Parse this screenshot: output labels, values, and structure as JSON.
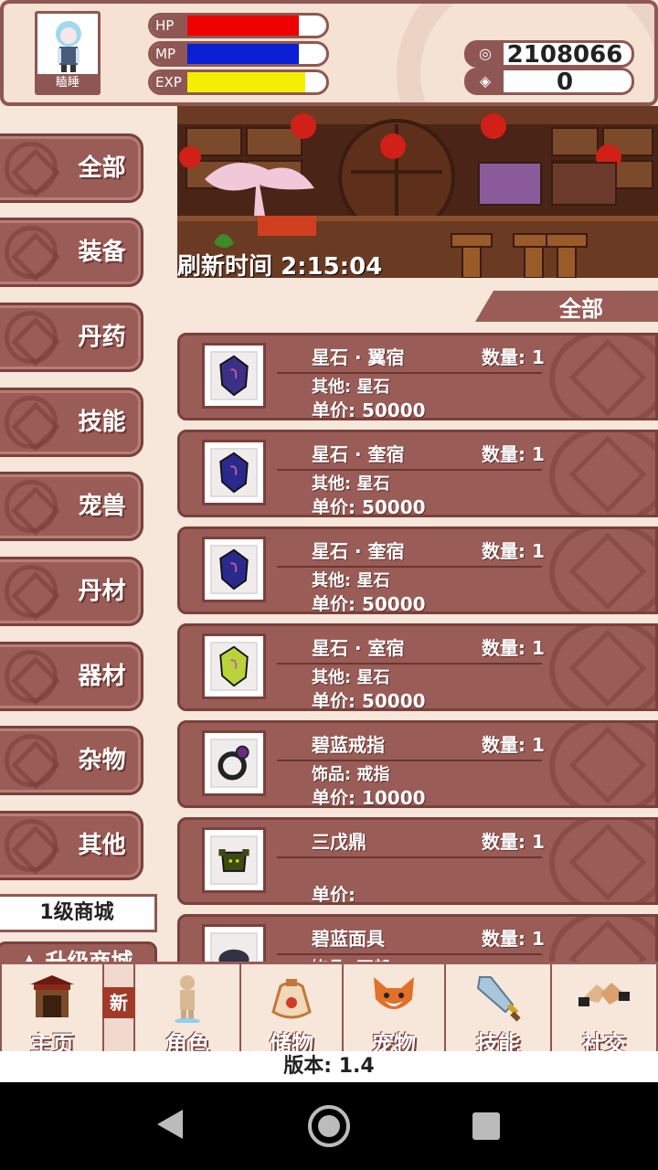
{
  "player": {
    "name": "瞌睡",
    "bars": [
      {
        "label": "HP",
        "fill": 0.8,
        "color": "#ee0000"
      },
      {
        "label": "MP",
        "fill": 0.8,
        "color": "#0a1fd6"
      },
      {
        "label": "EXP",
        "fill": 0.85,
        "color": "#f3ef00"
      }
    ],
    "gold": "2108066",
    "gems": "0"
  },
  "sidebar": {
    "categories": [
      "全部",
      "装备",
      "丹药",
      "技能",
      "宠兽",
      "丹材",
      "器材",
      "杂物",
      "其他"
    ],
    "shop_level": "1级商城",
    "upgrade": "升级商城"
  },
  "banner": {
    "refresh_label": "刷新时间",
    "refresh_time": "2:15:04"
  },
  "filter_tag": "全部",
  "items": [
    {
      "name": "星石 · 翼宿",
      "qty": "数量: 1",
      "category": "其他: 星石",
      "price": "单价: 50000",
      "icon": "purple-star-stone-icon",
      "color": "#3b2f86"
    },
    {
      "name": "星石 · 奎宿",
      "qty": "数量: 1",
      "category": "其他: 星石",
      "price": "单价: 50000",
      "icon": "blue-star-stone-icon",
      "color": "#2a2a8c"
    },
    {
      "name": "星石 · 奎宿",
      "qty": "数量: 1",
      "category": "其他: 星石",
      "price": "单价: 50000",
      "icon": "blue-star-stone-icon",
      "color": "#2a2a8c"
    },
    {
      "name": "星石 · 室宿",
      "qty": "数量: 1",
      "category": "其他: 星石",
      "price": "单价: 50000",
      "icon": "green-star-stone-icon",
      "color": "#b9d33a"
    },
    {
      "name": "碧蓝戒指",
      "qty": "数量: 1",
      "category": "饰品: 戒指",
      "price": "单价: 10000",
      "icon": "ring-icon",
      "color": "#555"
    },
    {
      "name": "三戊鼎",
      "qty": "数量: 1",
      "category": "",
      "price": "单价:",
      "icon": "cauldron-icon",
      "color": "#3d4a16"
    },
    {
      "name": "碧蓝面具",
      "qty": "数量: 1",
      "category": "饰品: 面部",
      "price": "",
      "icon": "mask-icon",
      "color": "#334"
    }
  ],
  "nav": [
    {
      "label": "主页",
      "icon": "gate-icon"
    },
    {
      "label": "角色",
      "icon": "figure-icon"
    },
    {
      "label": "储物",
      "icon": "bag-icon"
    },
    {
      "label": "宠物",
      "icon": "fox-icon"
    },
    {
      "label": "技能",
      "icon": "sword-icon"
    },
    {
      "label": "社交",
      "icon": "handshake-icon"
    }
  ],
  "new_badge": "新",
  "version": "版本: 1.4"
}
